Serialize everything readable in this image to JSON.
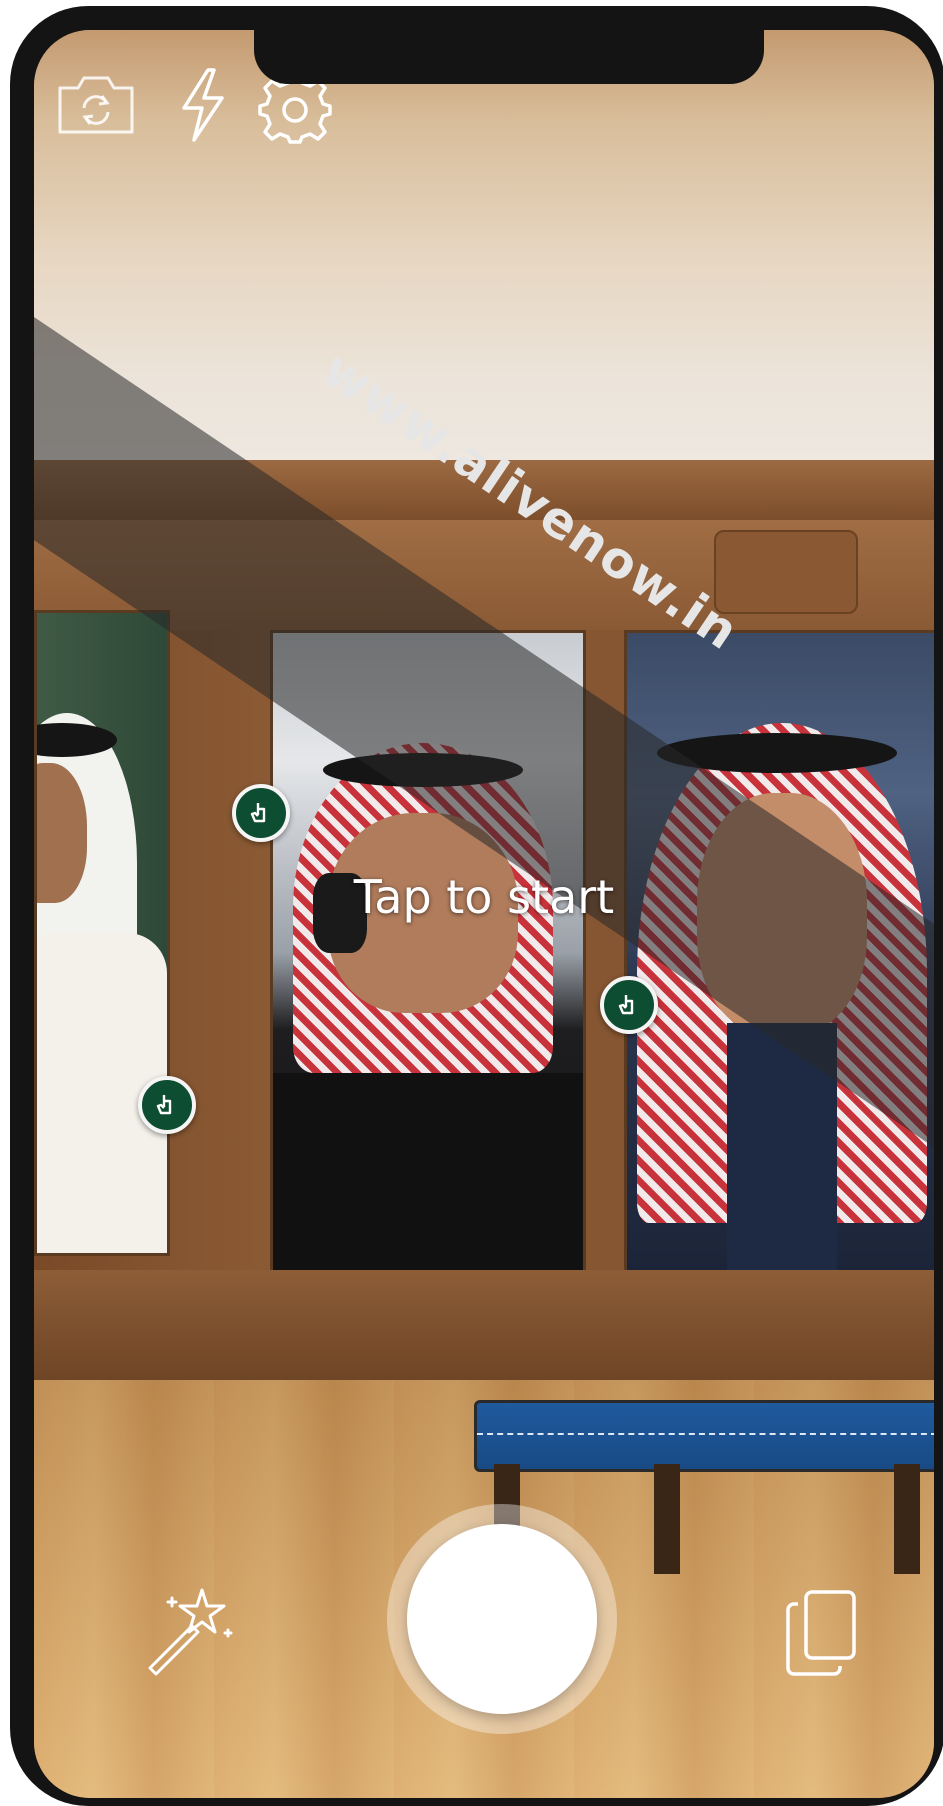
{
  "top_bar": {
    "camera_flip_icon": "camera-flip-icon",
    "flash_icon": "lightning-icon",
    "settings_icon": "gear-icon"
  },
  "watermark": {
    "text": "www.alivenow.in"
  },
  "prompt": {
    "text": "Tap to start"
  },
  "hotspots": [
    {
      "icon": "hand-pointer-icon"
    },
    {
      "icon": "hand-pointer-icon"
    },
    {
      "icon": "hand-pointer-icon"
    }
  ],
  "bottom_bar": {
    "effects_icon": "magic-wand-icon",
    "capture_button": "shutter",
    "gallery_icon": "stacked-cards-icon"
  },
  "colors": {
    "hotspot_fill": "#0d4d32",
    "hotspot_border": "#f5f5f5",
    "bench": "#1f5a9e",
    "phone_frame": "#141414"
  }
}
